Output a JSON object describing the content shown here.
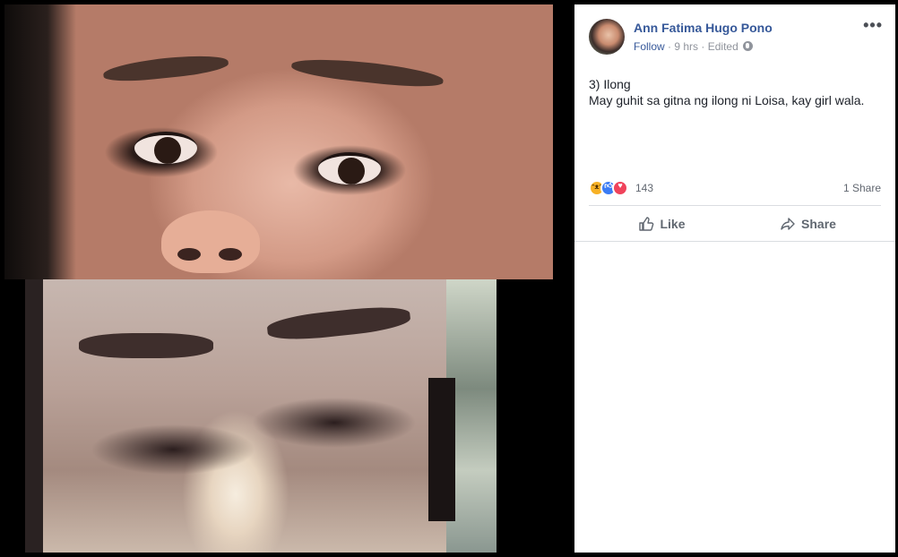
{
  "post": {
    "author": "Ann Fatima Hugo Pono",
    "follow": "Follow",
    "separator": " · ",
    "time": "9 hrs",
    "edited": "Edited",
    "more_icon": "•••",
    "text_lines": [
      "3) Ilong",
      "May guhit sa gitna ng ilong ni Loisa, kay girl wala."
    ],
    "reactions": {
      "icons": [
        "haha-icon",
        "like-icon",
        "love-icon"
      ],
      "count": "143"
    },
    "shares": "1 Share",
    "actions": {
      "like": "Like",
      "share": "Share"
    }
  },
  "colors": {
    "link": "#365899",
    "meta": "#90949c",
    "text": "#1d2129",
    "action": "#606770",
    "like_blue": "#3b7cf5",
    "love_red": "#f0435b",
    "haha_yellow": "#f7b125"
  }
}
